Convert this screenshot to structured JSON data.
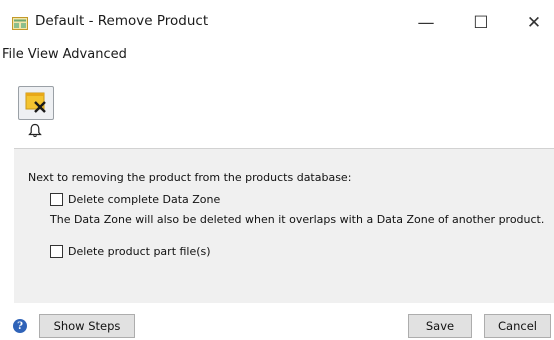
{
  "window": {
    "title": "Default - Remove Product",
    "minimize_glyph": "—",
    "maximize_glyph": "☐",
    "close_glyph": "✕",
    "title_icon": "app-window-icon"
  },
  "menubar": {
    "items": [
      "File",
      "View",
      "Advanced"
    ]
  },
  "toolbar": {
    "remove_icon": "remove-product-icon",
    "notification_icon": "bell-icon"
  },
  "panel": {
    "intro": "Next to removing the product from the products database:",
    "option_delete_zone": {
      "label": "Delete complete Data Zone",
      "checked": false
    },
    "note": "The Data Zone will also be deleted when it overlaps with a Data Zone of another product.",
    "option_delete_files": {
      "label": "Delete product part file(s)",
      "checked": false
    }
  },
  "footer": {
    "help_icon": "help-icon",
    "help_glyph": "?",
    "show_steps": "Show Steps",
    "save": "Save",
    "cancel": "Cancel"
  },
  "colors": {
    "panel_bg": "#f0f0f0",
    "button_bg": "#e1e1e1",
    "help_blue": "#2f63b8",
    "accent_yellow": "#f4c430"
  }
}
